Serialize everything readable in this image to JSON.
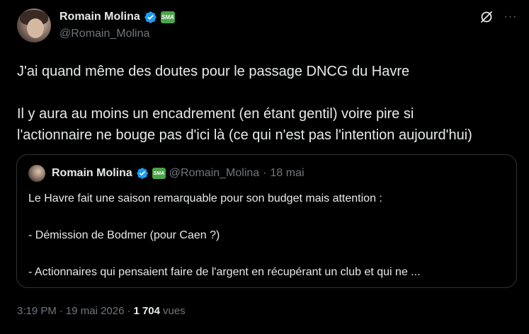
{
  "author": {
    "display_name": "Romain Molina",
    "handle": "@Romain_Molina",
    "verified_color": "#1d9bf0",
    "affiliate_badge_text": "SMA"
  },
  "header_actions": {
    "grok_icon": "grok-icon",
    "more_icon": "more-icon",
    "more_glyph": "···"
  },
  "tweet": {
    "line1": "J'ai quand même des doutes pour le passage DNCG du Havre",
    "line2": "Il y aura au moins un encadrement (en étant gentil) voire pire si",
    "line3": "l'actionnaire ne bouge pas d'ici là (ce qui n'est pas l'intention aujourd'hui)"
  },
  "quote": {
    "display_name": "Romain Molina",
    "handle": "@Romain_Molina",
    "separator": "·",
    "date": "18 mai",
    "affiliate_badge_text": "SMA",
    "line1": "Le Havre fait une saison remarquable pour son budget mais attention :",
    "line2": "- Démission de Bodmer (pour Caen ?)",
    "line3": "- Actionnaires qui pensaient faire de l'argent en récupérant un club et qui ne ..."
  },
  "meta": {
    "time": "3:19 PM",
    "separator": "·",
    "date": "19 mai 2026",
    "views_count": "1 704",
    "views_label": "vues"
  },
  "colors": {
    "background": "#000000",
    "text": "#e7e9ea",
    "muted": "#71767b",
    "border": "#2f3336",
    "verified": "#1d9bf0",
    "affiliate": "#4da34a"
  }
}
